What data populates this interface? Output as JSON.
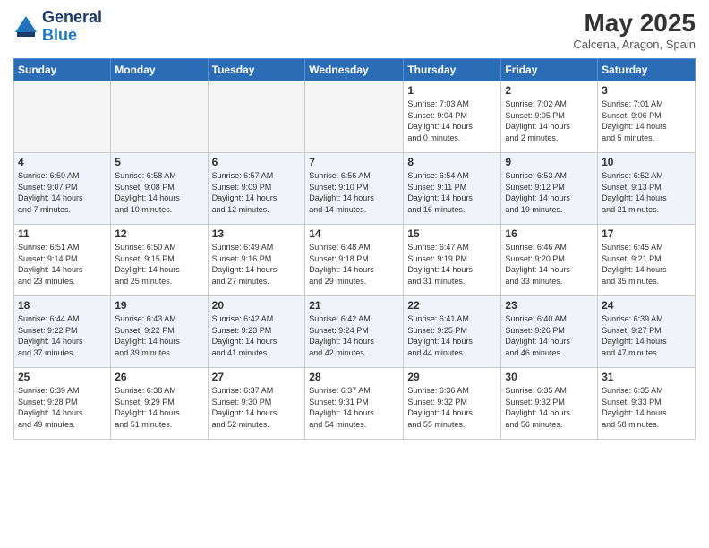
{
  "logo": {
    "line1": "General",
    "line2": "Blue"
  },
  "title": "May 2025",
  "subtitle": "Calcena, Aragon, Spain",
  "days_of_week": [
    "Sunday",
    "Monday",
    "Tuesday",
    "Wednesday",
    "Thursday",
    "Friday",
    "Saturday"
  ],
  "weeks": [
    [
      {
        "day": "",
        "info": ""
      },
      {
        "day": "",
        "info": ""
      },
      {
        "day": "",
        "info": ""
      },
      {
        "day": "",
        "info": ""
      },
      {
        "day": "1",
        "info": "Sunrise: 7:03 AM\nSunset: 9:04 PM\nDaylight: 14 hours\nand 0 minutes."
      },
      {
        "day": "2",
        "info": "Sunrise: 7:02 AM\nSunset: 9:05 PM\nDaylight: 14 hours\nand 2 minutes."
      },
      {
        "day": "3",
        "info": "Sunrise: 7:01 AM\nSunset: 9:06 PM\nDaylight: 14 hours\nand 5 minutes."
      }
    ],
    [
      {
        "day": "4",
        "info": "Sunrise: 6:59 AM\nSunset: 9:07 PM\nDaylight: 14 hours\nand 7 minutes."
      },
      {
        "day": "5",
        "info": "Sunrise: 6:58 AM\nSunset: 9:08 PM\nDaylight: 14 hours\nand 10 minutes."
      },
      {
        "day": "6",
        "info": "Sunrise: 6:57 AM\nSunset: 9:09 PM\nDaylight: 14 hours\nand 12 minutes."
      },
      {
        "day": "7",
        "info": "Sunrise: 6:56 AM\nSunset: 9:10 PM\nDaylight: 14 hours\nand 14 minutes."
      },
      {
        "day": "8",
        "info": "Sunrise: 6:54 AM\nSunset: 9:11 PM\nDaylight: 14 hours\nand 16 minutes."
      },
      {
        "day": "9",
        "info": "Sunrise: 6:53 AM\nSunset: 9:12 PM\nDaylight: 14 hours\nand 19 minutes."
      },
      {
        "day": "10",
        "info": "Sunrise: 6:52 AM\nSunset: 9:13 PM\nDaylight: 14 hours\nand 21 minutes."
      }
    ],
    [
      {
        "day": "11",
        "info": "Sunrise: 6:51 AM\nSunset: 9:14 PM\nDaylight: 14 hours\nand 23 minutes."
      },
      {
        "day": "12",
        "info": "Sunrise: 6:50 AM\nSunset: 9:15 PM\nDaylight: 14 hours\nand 25 minutes."
      },
      {
        "day": "13",
        "info": "Sunrise: 6:49 AM\nSunset: 9:16 PM\nDaylight: 14 hours\nand 27 minutes."
      },
      {
        "day": "14",
        "info": "Sunrise: 6:48 AM\nSunset: 9:18 PM\nDaylight: 14 hours\nand 29 minutes."
      },
      {
        "day": "15",
        "info": "Sunrise: 6:47 AM\nSunset: 9:19 PM\nDaylight: 14 hours\nand 31 minutes."
      },
      {
        "day": "16",
        "info": "Sunrise: 6:46 AM\nSunset: 9:20 PM\nDaylight: 14 hours\nand 33 minutes."
      },
      {
        "day": "17",
        "info": "Sunrise: 6:45 AM\nSunset: 9:21 PM\nDaylight: 14 hours\nand 35 minutes."
      }
    ],
    [
      {
        "day": "18",
        "info": "Sunrise: 6:44 AM\nSunset: 9:22 PM\nDaylight: 14 hours\nand 37 minutes."
      },
      {
        "day": "19",
        "info": "Sunrise: 6:43 AM\nSunset: 9:22 PM\nDaylight: 14 hours\nand 39 minutes."
      },
      {
        "day": "20",
        "info": "Sunrise: 6:42 AM\nSunset: 9:23 PM\nDaylight: 14 hours\nand 41 minutes."
      },
      {
        "day": "21",
        "info": "Sunrise: 6:42 AM\nSunset: 9:24 PM\nDaylight: 14 hours\nand 42 minutes."
      },
      {
        "day": "22",
        "info": "Sunrise: 6:41 AM\nSunset: 9:25 PM\nDaylight: 14 hours\nand 44 minutes."
      },
      {
        "day": "23",
        "info": "Sunrise: 6:40 AM\nSunset: 9:26 PM\nDaylight: 14 hours\nand 46 minutes."
      },
      {
        "day": "24",
        "info": "Sunrise: 6:39 AM\nSunset: 9:27 PM\nDaylight: 14 hours\nand 47 minutes."
      }
    ],
    [
      {
        "day": "25",
        "info": "Sunrise: 6:39 AM\nSunset: 9:28 PM\nDaylight: 14 hours\nand 49 minutes."
      },
      {
        "day": "26",
        "info": "Sunrise: 6:38 AM\nSunset: 9:29 PM\nDaylight: 14 hours\nand 51 minutes."
      },
      {
        "day": "27",
        "info": "Sunrise: 6:37 AM\nSunset: 9:30 PM\nDaylight: 14 hours\nand 52 minutes."
      },
      {
        "day": "28",
        "info": "Sunrise: 6:37 AM\nSunset: 9:31 PM\nDaylight: 14 hours\nand 54 minutes."
      },
      {
        "day": "29",
        "info": "Sunrise: 6:36 AM\nSunset: 9:32 PM\nDaylight: 14 hours\nand 55 minutes."
      },
      {
        "day": "30",
        "info": "Sunrise: 6:35 AM\nSunset: 9:32 PM\nDaylight: 14 hours\nand 56 minutes."
      },
      {
        "day": "31",
        "info": "Sunrise: 6:35 AM\nSunset: 9:33 PM\nDaylight: 14 hours\nand 58 minutes."
      }
    ]
  ]
}
